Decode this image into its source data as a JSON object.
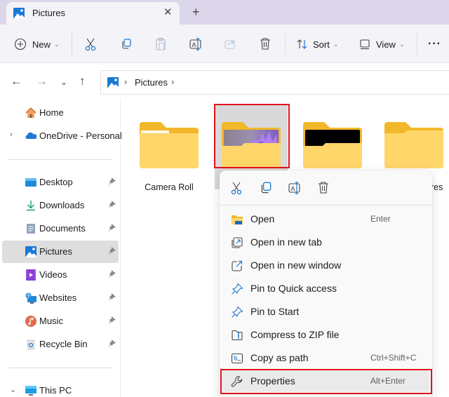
{
  "window": {
    "tab_title": "Pictures",
    "tab_close": "✕",
    "new_tab": "+"
  },
  "toolbar": {
    "new_label": "New",
    "sort_label": "Sort",
    "view_label": "View",
    "more_label": "···",
    "chevron": "⌄",
    "icons": [
      "plus-circle-icon",
      "cut-icon",
      "copy-icon",
      "paste-icon",
      "rename-icon",
      "share-icon",
      "delete-icon",
      "sort-icon",
      "view-icon",
      "more-icon"
    ]
  },
  "nav": {
    "back": "←",
    "forward": "→",
    "recent": "⌄",
    "up": "↑",
    "breadcrumb": [
      "Pictures"
    ],
    "sep": "›"
  },
  "sidebar": {
    "top_items": [
      {
        "label": "Home",
        "icon": "home-icon"
      },
      {
        "label": "OneDrive - Personal",
        "icon": "onedrive-icon",
        "expand": "›"
      }
    ],
    "pinned_items": [
      {
        "label": "Desktop",
        "icon": "desktop-icon"
      },
      {
        "label": "Downloads",
        "icon": "downloads-icon"
      },
      {
        "label": "Documents",
        "icon": "documents-icon"
      },
      {
        "label": "Pictures",
        "icon": "pictures-icon",
        "selected": true
      },
      {
        "label": "Videos",
        "icon": "videos-icon"
      },
      {
        "label": "Websites",
        "icon": "websites-icon"
      },
      {
        "label": "Music",
        "icon": "music-icon"
      },
      {
        "label": "Recycle Bin",
        "icon": "recycle-bin-icon"
      }
    ],
    "bottom_items": [
      {
        "label": "This PC",
        "icon": "this-pc-icon",
        "expand": "⌄"
      }
    ]
  },
  "content": {
    "folders": [
      {
        "label": "Camera Roll",
        "preview": "none"
      },
      {
        "label": "",
        "preview": "purple-flower",
        "selected": true
      },
      {
        "label": "",
        "preview": "black"
      },
      {
        "label": "res",
        "preview": "none"
      }
    ]
  },
  "context_menu": {
    "quick_actions": [
      "cut-icon",
      "copy-icon",
      "rename-icon",
      "delete-icon"
    ],
    "items": [
      {
        "label": "Open",
        "shortcut": "Enter",
        "icon": "folder-open-icon"
      },
      {
        "label": "Open in new tab",
        "shortcut": "",
        "icon": "new-tab-icon"
      },
      {
        "label": "Open in new window",
        "shortcut": "",
        "icon": "new-window-icon"
      },
      {
        "label": "Pin to Quick access",
        "shortcut": "",
        "icon": "pin-icon"
      },
      {
        "label": "Pin to Start",
        "shortcut": "",
        "icon": "pin-icon"
      },
      {
        "label": "Compress to ZIP file",
        "shortcut": "",
        "icon": "zip-icon"
      },
      {
        "label": "Copy as path",
        "shortcut": "Ctrl+Shift+C",
        "icon": "copy-path-icon"
      },
      {
        "label": "Properties",
        "shortcut": "Alt+Enter",
        "icon": "wrench-icon",
        "highlighted": true
      }
    ]
  },
  "colors": {
    "accent": "#0067c0",
    "highlight_box": "#e3111a",
    "folder_yellow": "#ffd55c"
  }
}
